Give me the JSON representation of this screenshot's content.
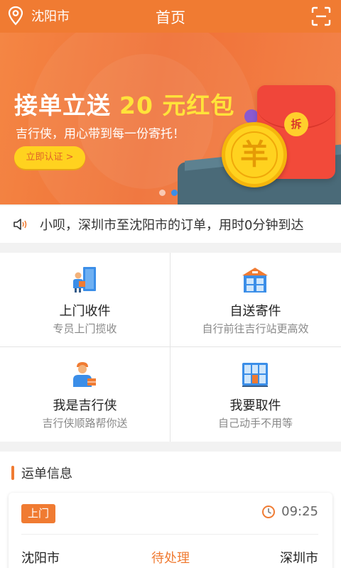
{
  "header": {
    "city": "沈阳市",
    "title": "首页",
    "location_icon": "location-pin-icon",
    "scan_icon": "scan-icon"
  },
  "banner": {
    "headline": "接单立送",
    "headline_highlight": "20 元红包",
    "subtitle": "吉行侠，用心带到每一份寄托！",
    "cta": "立即认证 >",
    "envelope_text": "拆",
    "coin_symbol": "羊",
    "active_slide": 2,
    "slide_count": 2
  },
  "notice": {
    "icon": "speaker-icon",
    "text": "小呗，深圳市至沈阳市的订单，用时0分钟到达"
  },
  "services": [
    {
      "title": "上门收件",
      "subtitle": "专员上门揽收",
      "icon": "courier-door-icon"
    },
    {
      "title": "自送寄件",
      "subtitle": "自行前往吉行站更高效",
      "icon": "station-icon"
    },
    {
      "title": "我是吉行侠",
      "subtitle": "吉行侠顺路帮你送",
      "icon": "courier-person-icon"
    },
    {
      "title": "我要取件",
      "subtitle": "自己动手不用等",
      "icon": "locker-icon"
    }
  ],
  "waybill": {
    "section_title": "运单信息",
    "tag": "上门",
    "time": "09:25",
    "from": "沈阳市",
    "status": "待处理",
    "to": "深圳市"
  },
  "colors": {
    "brand": "#f07b32",
    "highlight": "#ffe33a",
    "cta_bg": "#ffd21f",
    "dot_active": "#3b8ee8"
  }
}
